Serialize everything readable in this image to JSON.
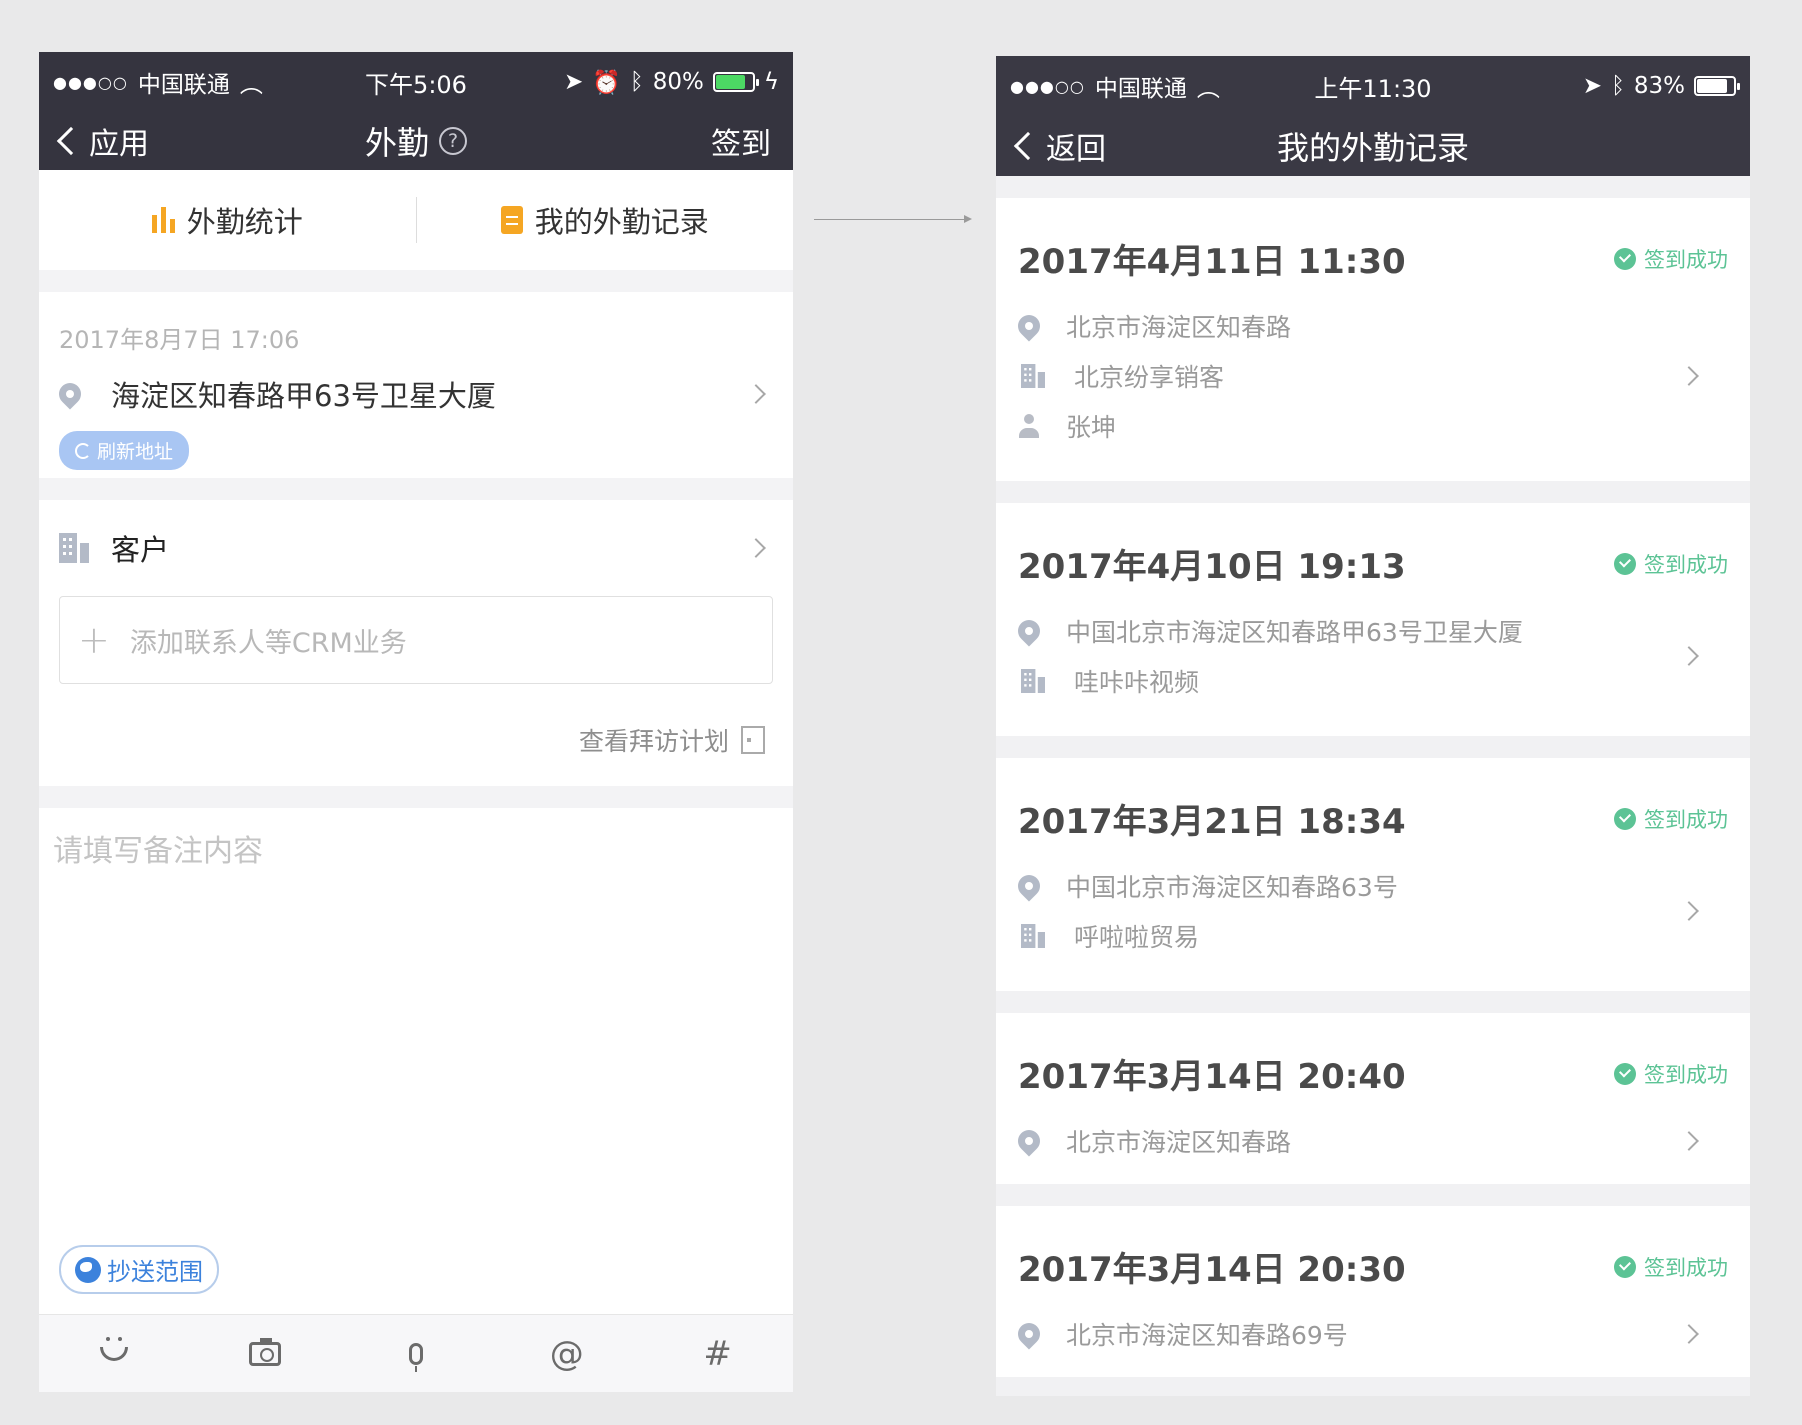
{
  "left_phone": {
    "status": {
      "carrier": "中国联通",
      "time": "下午5:06",
      "battery": "80%",
      "battery_level": 0.8,
      "battery_color": "#4cd964"
    },
    "nav": {
      "back_label": "应用",
      "title": "外勤",
      "help_glyph": "?",
      "action_label": "签到"
    },
    "tabs": [
      {
        "label": "外勤统计",
        "icon": "bar-chart-icon"
      },
      {
        "label": "我的外勤记录",
        "icon": "document-icon"
      }
    ],
    "location": {
      "time": "2017年8月7日 17:06",
      "address": "海淀区知春路甲63号卫星大厦",
      "refresh_label": "刷新地址"
    },
    "customer": {
      "label": "客户",
      "crm_placeholder": "添加联系人等CRM业务",
      "visit_plan_label": "查看拜访计划"
    },
    "note_placeholder": "请填写备注内容",
    "cc_label": "抄送范围",
    "toolbar": {
      "at_glyph": "@",
      "hash_glyph": "#",
      "icons": [
        "emoji-icon",
        "camera-icon",
        "microphone-icon",
        "at-icon",
        "hashtag-icon"
      ]
    }
  },
  "right_phone": {
    "status": {
      "carrier": "中国联通",
      "time": "上午11:30",
      "battery": "83%",
      "battery_level": 0.83,
      "battery_color": "#ffffff"
    },
    "nav": {
      "back_label": "返回",
      "title": "我的外勤记录"
    },
    "records": [
      {
        "datetime": "2017年4月11日 11:30",
        "status": "签到成功",
        "address": "北京市海淀区知春路",
        "company": "北京纷享销客",
        "person": "张坤"
      },
      {
        "datetime": "2017年4月10日 19:13",
        "status": "签到成功",
        "address": "中国北京市海淀区知春路甲63号卫星大厦",
        "company": "哇咔咔视频"
      },
      {
        "datetime": "2017年3月21日 18:34",
        "status": "签到成功",
        "address": "中国北京市海淀区知春路63号",
        "company": "呼啦啦贸易"
      },
      {
        "datetime": "2017年3月14日 20:40",
        "status": "签到成功",
        "address": "北京市海淀区知春路"
      },
      {
        "datetime": "2017年3月14日 20:30",
        "status": "签到成功",
        "address": "北京市海淀区知春路69号"
      }
    ],
    "success_color": "#5cc395"
  }
}
